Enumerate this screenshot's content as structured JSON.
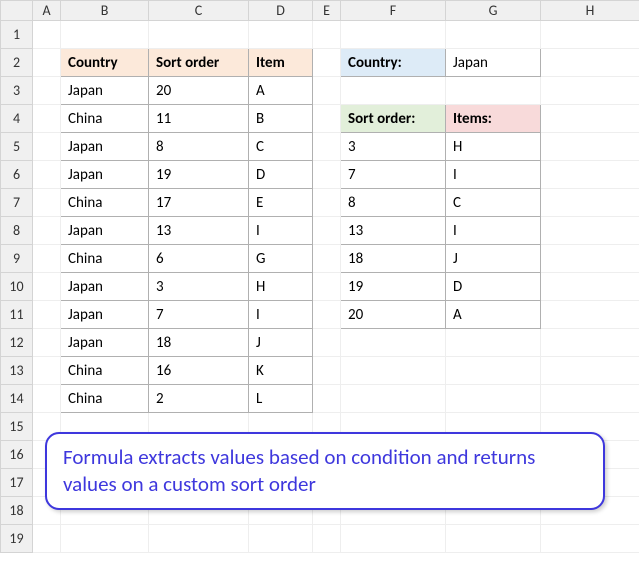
{
  "columns": [
    "",
    "A",
    "B",
    "C",
    "D",
    "E",
    "F",
    "G",
    "H"
  ],
  "rows": [
    "1",
    "2",
    "3",
    "4",
    "5",
    "6",
    "7",
    "8",
    "9",
    "10",
    "11",
    "12",
    "13",
    "14",
    "15",
    "16",
    "17",
    "18",
    "19"
  ],
  "main": {
    "headers": {
      "country": "Country",
      "sort": "Sort order",
      "item": "Item"
    },
    "data": [
      {
        "country": "Japan",
        "sort": "20",
        "item": "A"
      },
      {
        "country": "China",
        "sort": "11",
        "item": "B"
      },
      {
        "country": "Japan",
        "sort": "8",
        "item": "C"
      },
      {
        "country": "Japan",
        "sort": "19",
        "item": "D"
      },
      {
        "country": "China",
        "sort": "17",
        "item": "E"
      },
      {
        "country": "Japan",
        "sort": "13",
        "item": "I"
      },
      {
        "country": "China",
        "sort": "6",
        "item": "G"
      },
      {
        "country": "Japan",
        "sort": "3",
        "item": "H"
      },
      {
        "country": "Japan",
        "sort": "7",
        "item": "I"
      },
      {
        "country": "Japan",
        "sort": "18",
        "item": "J"
      },
      {
        "country": "China",
        "sort": "16",
        "item": "K"
      },
      {
        "country": "China",
        "sort": "2",
        "item": "L"
      }
    ]
  },
  "filter": {
    "label": "Country:",
    "value": "Japan"
  },
  "result": {
    "headers": {
      "sort": "Sort order:",
      "items": "Items:"
    },
    "data": [
      {
        "sort": "3",
        "item": "H"
      },
      {
        "sort": "7",
        "item": "I"
      },
      {
        "sort": "8",
        "item": "C"
      },
      {
        "sort": "13",
        "item": "I"
      },
      {
        "sort": "18",
        "item": "J"
      },
      {
        "sort": "19",
        "item": "D"
      },
      {
        "sort": "20",
        "item": "A"
      }
    ]
  },
  "callout": "Formula extracts values based on condition and returns values on a custom sort order"
}
